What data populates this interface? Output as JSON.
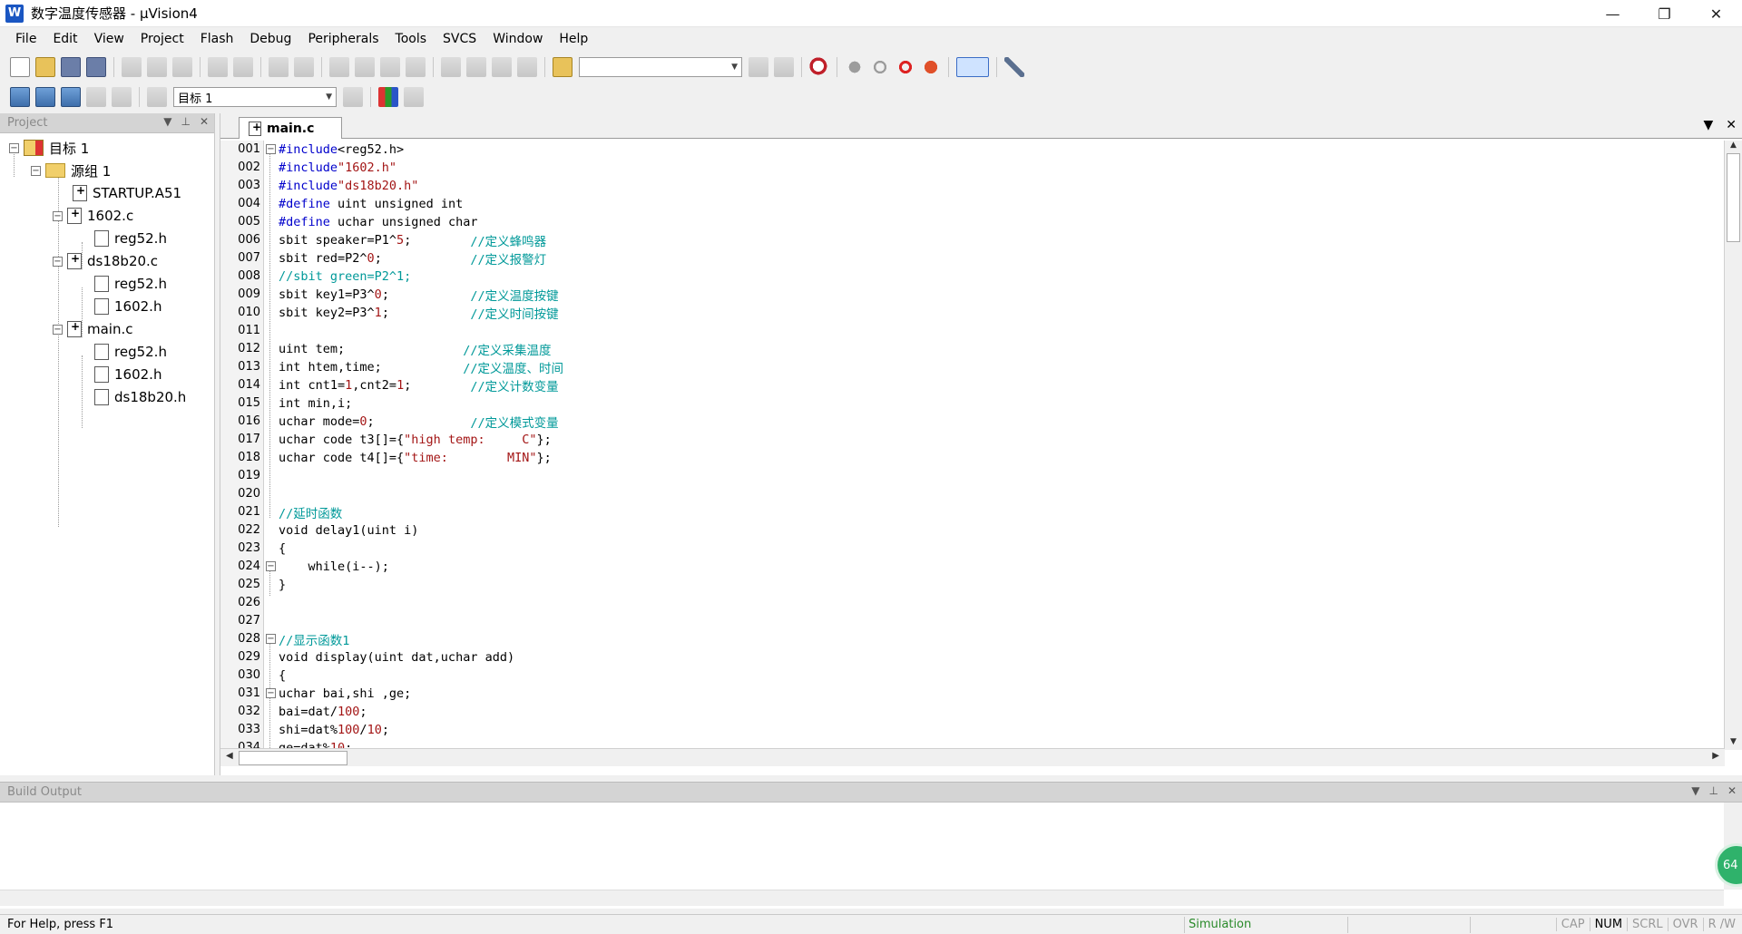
{
  "window": {
    "title": "数字温度传感器 - µVision4",
    "app_icon": "W",
    "minimize": "—",
    "restore": "❐",
    "close": "✕"
  },
  "menu": [
    {
      "label": "File"
    },
    {
      "label": "Edit"
    },
    {
      "label": "View"
    },
    {
      "label": "Project"
    },
    {
      "label": "Flash"
    },
    {
      "label": "Debug"
    },
    {
      "label": "Peripherals"
    },
    {
      "label": "Tools"
    },
    {
      "label": "SVCS"
    },
    {
      "label": "Window"
    },
    {
      "label": "Help"
    }
  ],
  "toolbar2": {
    "target_combo": "目标 1"
  },
  "project_panel": {
    "title": "Project",
    "tree": [
      {
        "label": "目标 1",
        "kind": "target"
      },
      {
        "label": "源组 1",
        "kind": "group"
      },
      {
        "label": "STARTUP.A51",
        "kind": "file"
      },
      {
        "label": "1602.c",
        "kind": "file"
      },
      {
        "label": "reg52.h",
        "kind": "header"
      },
      {
        "label": "ds18b20.c",
        "kind": "file"
      },
      {
        "label": "reg52.h",
        "kind": "header"
      },
      {
        "label": "1602.h",
        "kind": "header"
      },
      {
        "label": "main.c",
        "kind": "file"
      },
      {
        "label": "reg52.h",
        "kind": "header"
      },
      {
        "label": "1602.h",
        "kind": "header"
      },
      {
        "label": "ds18b20.h",
        "kind": "header"
      }
    ]
  },
  "editor": {
    "active_tab": "main.c",
    "line_numbers": [
      "001",
      "002",
      "003",
      "004",
      "005",
      "006",
      "007",
      "008",
      "009",
      "010",
      "011",
      "012",
      "013",
      "014",
      "015",
      "016",
      "017",
      "018",
      "019",
      "020",
      "021",
      "022",
      "023",
      "024",
      "025",
      "026",
      "027",
      "028",
      "029",
      "030",
      "031",
      "032",
      "033",
      "034"
    ]
  },
  "build_output": {
    "title": "Build Output"
  },
  "status": {
    "help": "For Help, press F1",
    "mode": "Simulation",
    "keys": [
      "CAP",
      "NUM",
      "SCRL",
      "OVR",
      "R /W"
    ],
    "active_key": "NUM"
  },
  "float_button": {
    "label": "64"
  },
  "colors": {
    "keyword": "#0000cc",
    "string": "#a31515",
    "comment": "#009999",
    "simulation": "#2a8a2a"
  }
}
